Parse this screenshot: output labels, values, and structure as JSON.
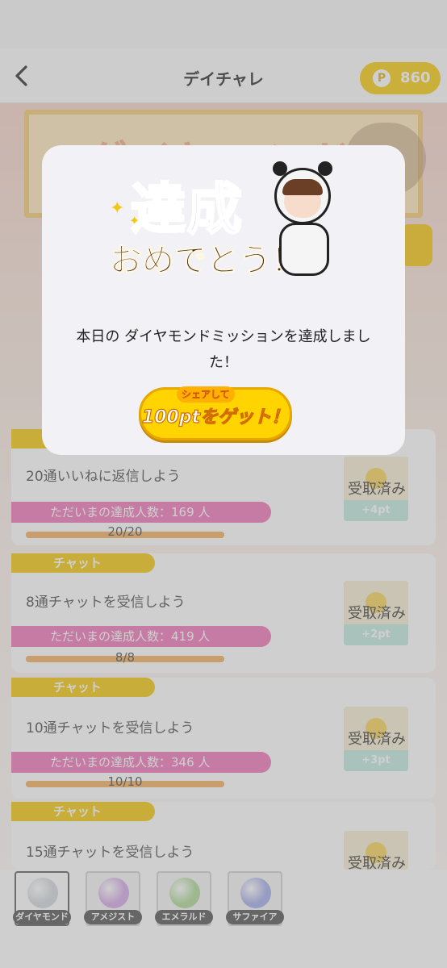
{
  "header": {
    "title": "デイチャレ",
    "points_symbol": "P",
    "points": "860"
  },
  "banner": {
    "text": "ダイヤモンド"
  },
  "modal": {
    "stamp_line1": "達成",
    "stamp_line2": "おめでとう！",
    "message": "本日の ダイヤモンドミッションを達成しました！",
    "share_small": "シェアして",
    "share_main": "100ptをゲット！"
  },
  "missions": [
    {
      "category": "",
      "title": "20通いいねに返信しよう",
      "achievers": "ただいまの達成人数：169 人",
      "progress_text": "20/20",
      "progress": 1.0,
      "reward": "+4pt",
      "claim_label": "受取済み"
    },
    {
      "category": "チャット",
      "title": "8通チャットを受信しよう",
      "achievers": "ただいまの達成人数：419 人",
      "progress_text": "8/8",
      "progress": 1.0,
      "reward": "+2pt",
      "claim_label": "受取済み"
    },
    {
      "category": "チャット",
      "title": "10通チャットを受信しよう",
      "achievers": "ただいまの達成人数：346 人",
      "progress_text": "10/10",
      "progress": 1.0,
      "reward": "+3pt",
      "claim_label": "受取済み"
    },
    {
      "category": "チャット",
      "title": "15通チャットを受信しよう",
      "claim_label": "受取済み"
    }
  ],
  "tabs": [
    {
      "label": "ダイヤモンド",
      "color": "#cfd6dc",
      "active": true
    },
    {
      "label": "アメジスト",
      "color": "#d3a3e6",
      "active": false
    },
    {
      "label": "エメラルド",
      "color": "#a9d88f",
      "active": false
    },
    {
      "label": "サファイア",
      "color": "#9fa8e8",
      "active": false
    }
  ],
  "colors": {
    "accent_yellow": "#f5c400",
    "achiever_pink": "#ee6fb5",
    "progress_orange": "#f2ab55"
  }
}
